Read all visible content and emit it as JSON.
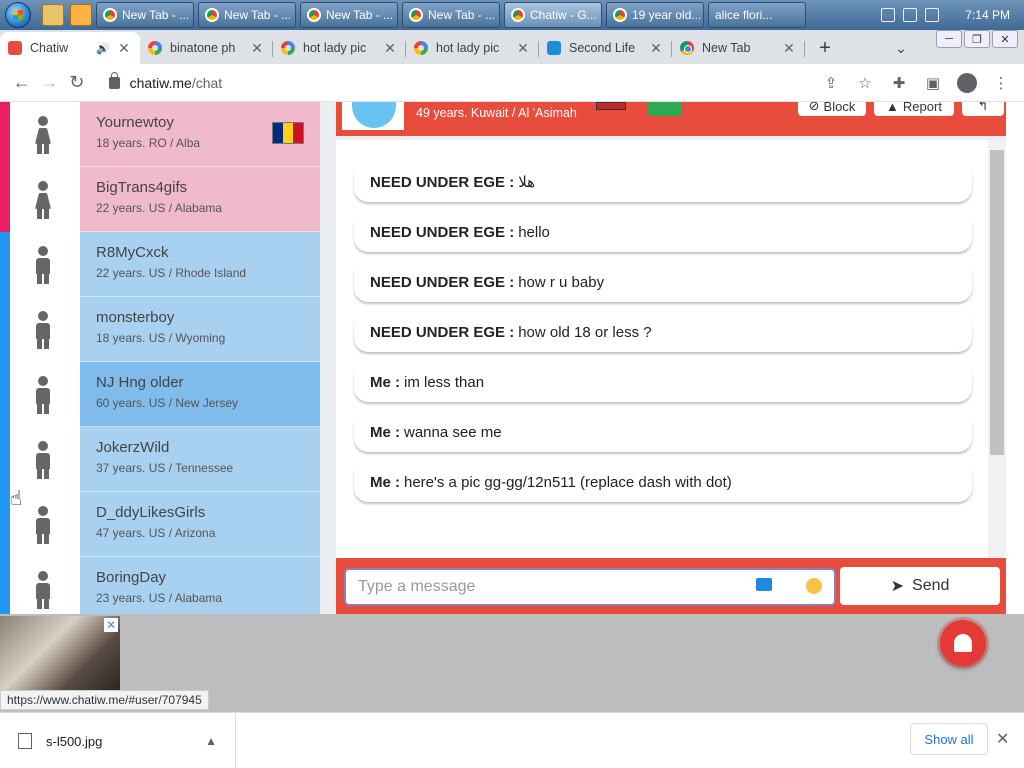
{
  "taskbar": {
    "tasks": [
      {
        "label": "New Tab - ...",
        "active": false
      },
      {
        "label": "New Tab - ...",
        "active": false
      },
      {
        "label": "New Tab - ...",
        "active": false
      },
      {
        "label": "New Tab - ...",
        "active": false
      },
      {
        "label": "Chatiw - G...",
        "active": true
      },
      {
        "label": "19 year old...",
        "active": false
      },
      {
        "label": "alice flori...",
        "active": false
      }
    ],
    "clock": "7:14 PM"
  },
  "browser": {
    "tabs": [
      {
        "label": "Chatiw",
        "icon": "chatiw",
        "active": true,
        "audio": true
      },
      {
        "label": "binatone ph",
        "icon": "google"
      },
      {
        "label": "hot lady pic",
        "icon": "google"
      },
      {
        "label": "hot lady pic",
        "icon": "google"
      },
      {
        "label": "Second Life",
        "icon": "sl"
      },
      {
        "label": "New Tab",
        "icon": "chrome"
      }
    ],
    "address": {
      "host": "chatiw.me",
      "path": "/chat"
    }
  },
  "users": [
    {
      "name": "Yournewtoy",
      "meta": "18 years. RO / Alba",
      "gender": "female",
      "flag": "ro"
    },
    {
      "name": "BigTrans4gifs",
      "meta": "22 years. US / Alabama",
      "gender": "female",
      "flag": "us"
    },
    {
      "name": "R8MyCxck",
      "meta": "22 years. US / Rhode Island",
      "gender": "male",
      "flag": "us"
    },
    {
      "name": "monsterboy",
      "meta": "18 years. US / Wyoming",
      "gender": "male",
      "flag": "us"
    },
    {
      "name": "NJ Hng older",
      "meta": "60 years. US / New Jersey",
      "gender": "male",
      "flag": "us",
      "hover": true
    },
    {
      "name": "JokerzWild",
      "meta": "37 years. US / Tennessee",
      "gender": "male",
      "flag": "us"
    },
    {
      "name": "D_ddyLikesGirls",
      "meta": "47 years. US / Arizona",
      "gender": "male",
      "flag": "us"
    },
    {
      "name": "BoringDay",
      "meta": "23 years. US / Alabama",
      "gender": "male",
      "flag": "us"
    }
  ],
  "chat": {
    "header": {
      "info": "49 years. Kuwait / Al 'Asimah",
      "block_label": "Block",
      "report_label": "Report"
    },
    "messages": [
      {
        "sender": "NEED UNDER EGE :",
        "text": "هلا"
      },
      {
        "sender": "NEED UNDER EGE :",
        "text": "hello"
      },
      {
        "sender": "NEED UNDER EGE :",
        "text": "how r u baby"
      },
      {
        "sender": "NEED UNDER EGE :",
        "text": "how old 18 or less ?"
      },
      {
        "sender": "Me :",
        "text": "im less than"
      },
      {
        "sender": "Me :",
        "text": "wanna see me"
      },
      {
        "sender": "Me :",
        "text": "here's a pic gg-gg/12n511 (replace dash with dot)"
      }
    ],
    "composer": {
      "placeholder": "Type a message",
      "send_label": "Send"
    }
  },
  "status_url": "https://www.chatiw.me/#user/707945",
  "downloads": {
    "file": "s-l500.jpg",
    "show_all": "Show all"
  },
  "colors": {
    "accent": "#e74c3c",
    "female": "#f0b9cc",
    "male": "#a8d0f0",
    "hover": "#7fbcec"
  }
}
